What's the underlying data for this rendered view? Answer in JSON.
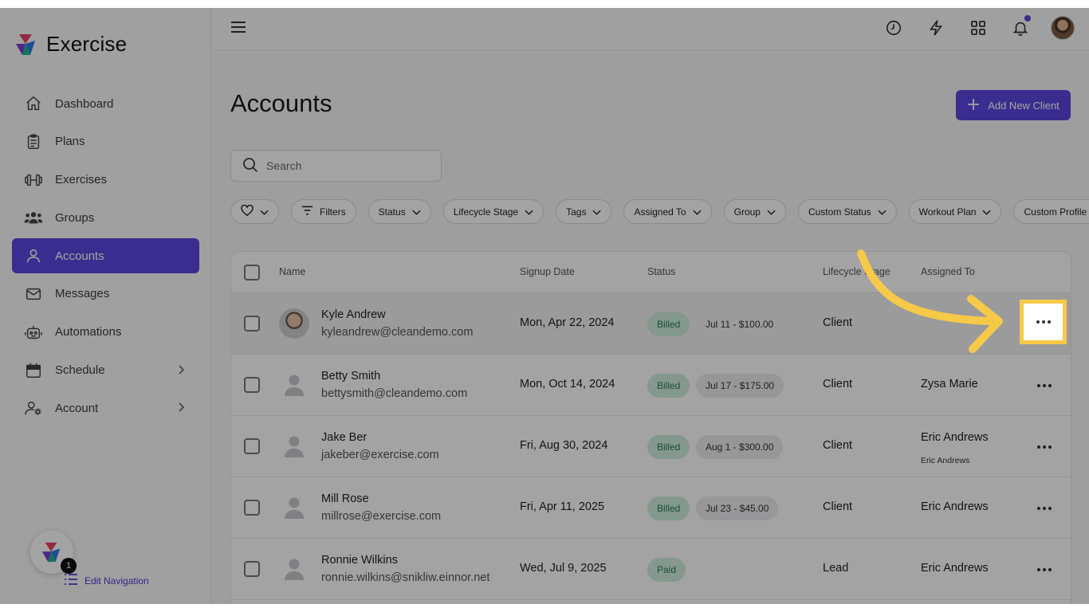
{
  "app": {
    "name": "Exercise"
  },
  "sidebar": {
    "items": [
      {
        "label": "Dashboard",
        "icon": "home-icon"
      },
      {
        "label": "Plans",
        "icon": "clipboard-icon"
      },
      {
        "label": "Exercises",
        "icon": "dumbbell-icon"
      },
      {
        "label": "Groups",
        "icon": "groups-icon"
      },
      {
        "label": "Accounts",
        "icon": "user-icon",
        "active": true
      },
      {
        "label": "Messages",
        "icon": "mail-icon"
      },
      {
        "label": "Automations",
        "icon": "robot-icon"
      },
      {
        "label": "Schedule",
        "icon": "calendar-icon",
        "chevron": true
      },
      {
        "label": "Account",
        "icon": "user-settings-icon",
        "chevron": true
      }
    ],
    "edit_navigation": "Edit Navigation",
    "badge_count": "1"
  },
  "page": {
    "title": "Accounts",
    "add_button": "Add New Client"
  },
  "search": {
    "placeholder": "Search"
  },
  "filters": [
    "Filters",
    "Status",
    "Lifecycle Stage",
    "Tags",
    "Assigned To",
    "Group",
    "Custom Status",
    "Workout Plan",
    "Custom Profile Field"
  ],
  "table": {
    "headers": {
      "name": "Name",
      "signup": "Signup Date",
      "status": "Status",
      "lifecycle": "Lifecycle Stage",
      "assigned": "Assigned To"
    },
    "rows": [
      {
        "name": "Kyle Andrew",
        "email": "kyleandrew@cleandemo.com",
        "date": "Mon, Apr 22, 2024",
        "status": "Billed",
        "amount": "Jul 11 - $100.00",
        "stage": "Client",
        "assigned": "",
        "assigned_sub": ""
      },
      {
        "name": "Betty Smith",
        "email": "bettysmith@cleandemo.com",
        "date": "Mon, Oct 14, 2024",
        "status": "Billed",
        "amount": "Jul 17 - $175.00",
        "stage": "Client",
        "assigned": "Zysa Marie",
        "assigned_sub": ""
      },
      {
        "name": "Jake Ber",
        "email": "jakeber@exercise.com",
        "date": "Fri, Aug 30, 2024",
        "status": "Billed",
        "amount": "Aug 1 - $300.00",
        "stage": "Client",
        "assigned": "Eric Andrews",
        "assigned_sub": "Eric Andrews"
      },
      {
        "name": "Mill Rose",
        "email": "millrose@exercise.com",
        "date": "Fri, Apr 11, 2025",
        "status": "Billed",
        "amount": "Jul 23 - $45.00",
        "stage": "Client",
        "assigned": "Eric Andrews",
        "assigned_sub": ""
      },
      {
        "name": "Ronnie Wilkins",
        "email": "ronnie.wilkins@snikliw.einnor.net",
        "date": "Wed, Jul 9, 2025",
        "status": "Paid",
        "amount": "",
        "stage": "Lead",
        "assigned": "Eric Andrews",
        "assigned_sub": ""
      }
    ]
  },
  "colors": {
    "accent": "#5b47e0",
    "highlight": "#f7c948",
    "billed_bg": "#cfeede"
  }
}
